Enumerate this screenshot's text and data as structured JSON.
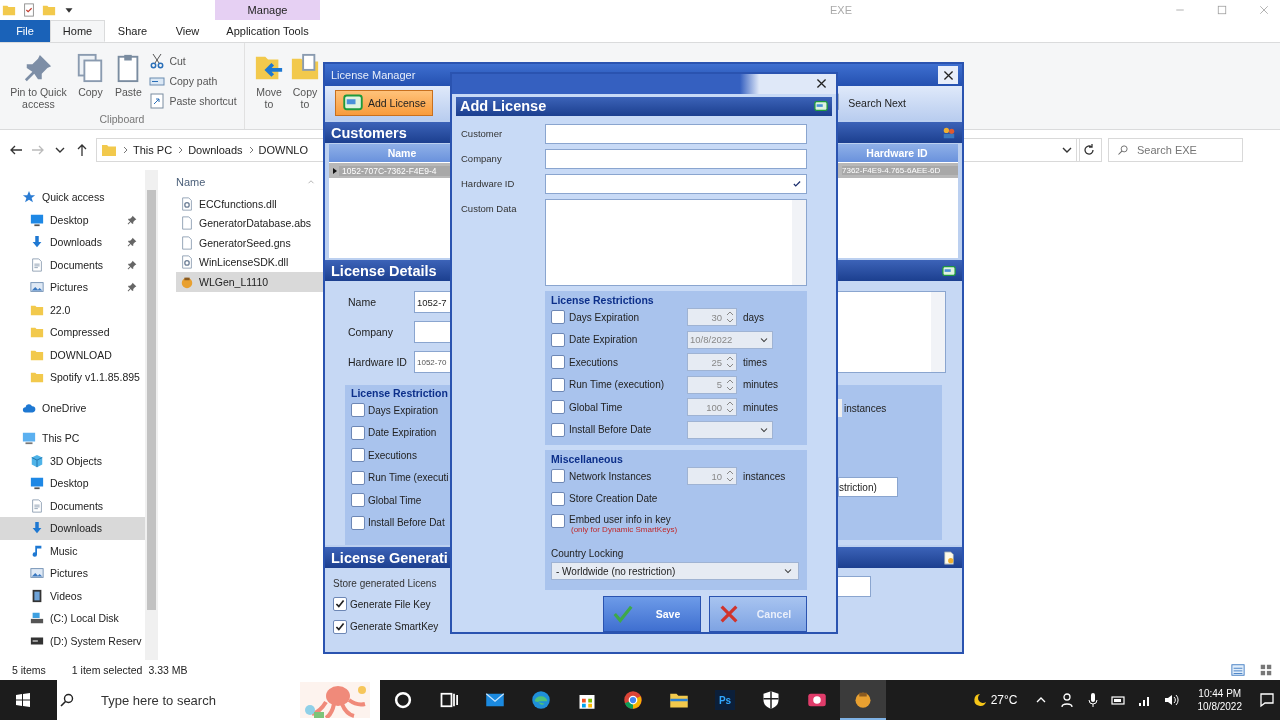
{
  "explorer": {
    "title": "EXE",
    "context_group": "Manage",
    "tabs": [
      {
        "label": "File",
        "kind": "menu",
        "selected": false
      },
      {
        "label": "Home",
        "kind": "tab",
        "selected": true
      },
      {
        "label": "Share",
        "kind": "tab",
        "selected": false
      },
      {
        "label": "View",
        "kind": "tab",
        "selected": false
      },
      {
        "label": "Application Tools",
        "kind": "context",
        "selected": false
      }
    ],
    "clipboard": {
      "large": [
        {
          "label": "Pin to Quick access",
          "kind": "pin"
        },
        {
          "label": "Copy",
          "kind": "copy"
        },
        {
          "label": "Paste",
          "kind": "paste"
        }
      ],
      "small": [
        {
          "label": "Cut",
          "kind": "cut"
        },
        {
          "label": "Copy path",
          "kind": "copypath"
        },
        {
          "label": "Paste shortcut",
          "kind": "shortcut"
        }
      ],
      "group": "Clipboard"
    },
    "organize": [
      {
        "label": "Move to",
        "kind": "move"
      },
      {
        "label": "Copy to",
        "kind": "copyto"
      }
    ],
    "breadcrumb": [
      "This PC",
      "Downloads",
      "DOWNLO"
    ],
    "search_placeholder": "Search EXE",
    "nav": [
      {
        "label": "Quick access",
        "kind": "star",
        "selected": false,
        "children": [
          {
            "label": "Desktop",
            "kind": "desktop",
            "pinned": true,
            "selected": false
          },
          {
            "label": "Downloads",
            "kind": "download",
            "pinned": true,
            "selected": false
          },
          {
            "label": "Documents",
            "kind": "document",
            "pinned": true,
            "selected": false
          },
          {
            "label": "Pictures",
            "kind": "pictures",
            "pinned": true,
            "selected": false
          },
          {
            "label": "22.0",
            "kind": "folder",
            "selected": false
          },
          {
            "label": "Compressed",
            "kind": "folder",
            "selected": false
          },
          {
            "label": "DOWNLOAD",
            "kind": "folder",
            "selected": false
          },
          {
            "label": "Spotify v1.1.85.895",
            "kind": "folder",
            "selected": false
          }
        ]
      },
      {
        "label": "OneDrive",
        "kind": "cloud",
        "selected": false
      },
      {
        "label": "This PC",
        "kind": "pc",
        "selected": false,
        "children": [
          {
            "label": "3D Objects",
            "kind": "objects",
            "selected": false
          },
          {
            "label": "Desktop",
            "kind": "desktop",
            "selected": false
          },
          {
            "label": "Documents",
            "kind": "document",
            "selected": false
          },
          {
            "label": "Downloads",
            "kind": "download",
            "selected": true
          },
          {
            "label": "Music",
            "kind": "music",
            "selected": false
          },
          {
            "label": "Pictures",
            "kind": "pictures",
            "selected": false
          },
          {
            "label": "Videos",
            "kind": "videos",
            "selected": false
          },
          {
            "label": "(C:) Local Disk",
            "kind": "disk",
            "selected": false
          },
          {
            "label": "(D:) System Reserv",
            "kind": "drive",
            "selected": false
          }
        ]
      }
    ],
    "files": {
      "column": "Name",
      "items": [
        {
          "name": "ECCfunctions.dll",
          "kind": "dll",
          "selected": false
        },
        {
          "name": "GeneratorDatabase.abs",
          "kind": "file",
          "selected": false
        },
        {
          "name": "GeneratorSeed.gns",
          "kind": "file",
          "selected": false
        },
        {
          "name": "WinLicenseSDK.dll",
          "kind": "dll",
          "selected": false
        },
        {
          "name": "WLGen_L1110",
          "kind": "exe",
          "selected": true
        }
      ]
    },
    "status": {
      "count": "5 items",
      "selection": "1 item selected",
      "size": "3.33 MB"
    }
  },
  "license_manager": {
    "title": "License Manager",
    "toolbar": [
      {
        "label": "Add License",
        "kind": "add",
        "selected": true
      },
      {
        "label": "Search Next",
        "kind": "searchnext",
        "selected": false
      }
    ],
    "customers": {
      "title": "Customers",
      "columns": [
        "Name",
        "Hardware ID"
      ],
      "rows": [
        {
          "cells": [
            "1052-707C-7362-F4E9-4",
            "7362-F4E9-4.765-6AEE-6D"
          ],
          "selected": true
        }
      ]
    },
    "details": {
      "title": "License Details",
      "fields": [
        {
          "label": "Name",
          "value": "1052-7"
        },
        {
          "label": "Company"
        },
        {
          "label": "Hardware ID",
          "value": "1052-70"
        }
      ],
      "restrictions": {
        "title": "License Restriction",
        "items": [
          {
            "label": "Days Expiration",
            "checked": false
          },
          {
            "label": "Date Expiration",
            "checked": false
          },
          {
            "label": "Executions",
            "checked": false
          },
          {
            "label": "Run Time (executi",
            "checked": false
          },
          {
            "label": "Global Time",
            "checked": false
          },
          {
            "label": "Install Before Dat",
            "checked": false
          }
        ]
      },
      "unit": "instances",
      "country": "striction)"
    },
    "generation": {
      "title": "License Generati",
      "note": "Store generated Licens",
      "options": [
        {
          "label": "Generate File Key",
          "checked": true
        },
        {
          "label": "Generate SmartKey",
          "checked": true
        }
      ]
    }
  },
  "add_license": {
    "title": "Add License",
    "fields": [
      {
        "label": "Customer",
        "kind": "text"
      },
      {
        "label": "Company",
        "kind": "text"
      },
      {
        "label": "Hardware ID",
        "kind": "check"
      },
      {
        "label": "Custom Data",
        "kind": "textarea"
      }
    ],
    "restrictions": {
      "title": "License Restrictions",
      "items": [
        {
          "label": "Days Expiration",
          "checked": false,
          "kind": "spin",
          "value": "30",
          "unit": "days"
        },
        {
          "label": "Date Expiration",
          "checked": false,
          "kind": "date",
          "value": "10/8/2022"
        },
        {
          "label": "Executions",
          "checked": false,
          "kind": "spin",
          "value": "25",
          "unit": "times"
        },
        {
          "label": "Run Time (execution)",
          "checked": false,
          "kind": "spin",
          "value": "5",
          "unit": "minutes"
        },
        {
          "label": "Global Time",
          "checked": false,
          "kind": "spin",
          "value": "100",
          "unit": "minutes"
        },
        {
          "label": "Install Before Date",
          "checked": false,
          "kind": "date"
        }
      ]
    },
    "misc": {
      "title": "Miscellaneous",
      "items": [
        {
          "label": "Network Instances",
          "checked": false,
          "kind": "spin",
          "value": "10",
          "unit": "instances"
        },
        {
          "label": "Store Creation Date",
          "checked": false,
          "kind": "plain"
        },
        {
          "label": "Embed user info in key",
          "checked": false,
          "kind": "plain",
          "note": "(only for Dynamic SmartKeys)"
        }
      ]
    },
    "country_label": "Country Locking",
    "country_value": "- Worldwide (no restriction)",
    "buttons": [
      {
        "label": "Save",
        "kind": "save"
      },
      {
        "label": "Cancel",
        "kind": "cancel"
      }
    ]
  },
  "taskbar": {
    "search_placeholder": "Type here to search",
    "apps": [
      {
        "kind": "cortana",
        "selected": false
      },
      {
        "kind": "taskview",
        "selected": false
      },
      {
        "kind": "mail",
        "selected": false
      },
      {
        "kind": "edge",
        "selected": false
      },
      {
        "kind": "store",
        "selected": false
      },
      {
        "kind": "chrome",
        "selected": false
      },
      {
        "kind": "explorer",
        "selected": false
      },
      {
        "kind": "photoshop",
        "label": "Ps",
        "selected": false
      },
      {
        "kind": "security",
        "selected": false
      },
      {
        "kind": "photos",
        "selected": false
      },
      {
        "kind": "wlgen",
        "selected": true
      }
    ],
    "temperature": "27°C",
    "time": "10:44 PM",
    "date": "10/8/2022"
  }
}
